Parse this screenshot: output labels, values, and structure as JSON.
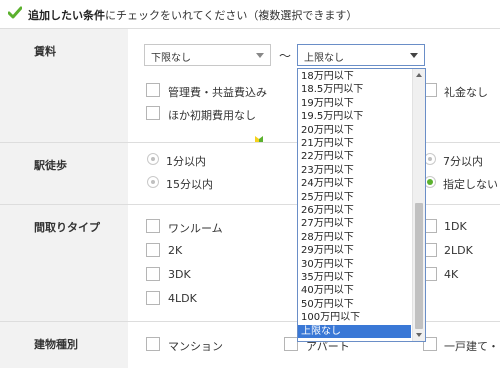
{
  "header": {
    "bold": "追加したい条件",
    "rest": "にチェックをいれてください（複数選択できます）"
  },
  "rent": {
    "label": "賃料",
    "min_select": "下限なし",
    "tilde": "～",
    "max_select": "上限なし",
    "checkboxes": [
      "管理費・共益費込み",
      "ほか初期費用なし",
      "礼金なし"
    ],
    "dropdown_options": [
      "18万円以下",
      "18.5万円以下",
      "19万円以下",
      "19.5万円以下",
      "20万円以下",
      "21万円以下",
      "22万円以下",
      "23万円以下",
      "24万円以下",
      "25万円以下",
      "26万円以下",
      "27万円以下",
      "28万円以下",
      "29万円以下",
      "30万円以下",
      "35万円以下",
      "40万円以下",
      "50万円以下",
      "100万円以下",
      "上限なし"
    ],
    "selected_option": "上限なし"
  },
  "walk": {
    "label": "駅徒歩",
    "options": [
      "1分以内",
      "15分以内",
      "7分以内",
      "指定しない"
    ],
    "selected": "指定しない"
  },
  "layout": {
    "label": "間取りタイプ",
    "options": [
      "ワンルーム",
      "2K",
      "3DK",
      "4LDK",
      "1DK",
      "2LDK",
      "4K"
    ]
  },
  "building": {
    "label": "建物種別",
    "options": [
      "マンション",
      "アパート",
      "一戸建て・そ"
    ]
  },
  "colors": {
    "accent": "#5bb12e",
    "selection": "#3a78d6",
    "focus_border": "#6a8ec7"
  }
}
